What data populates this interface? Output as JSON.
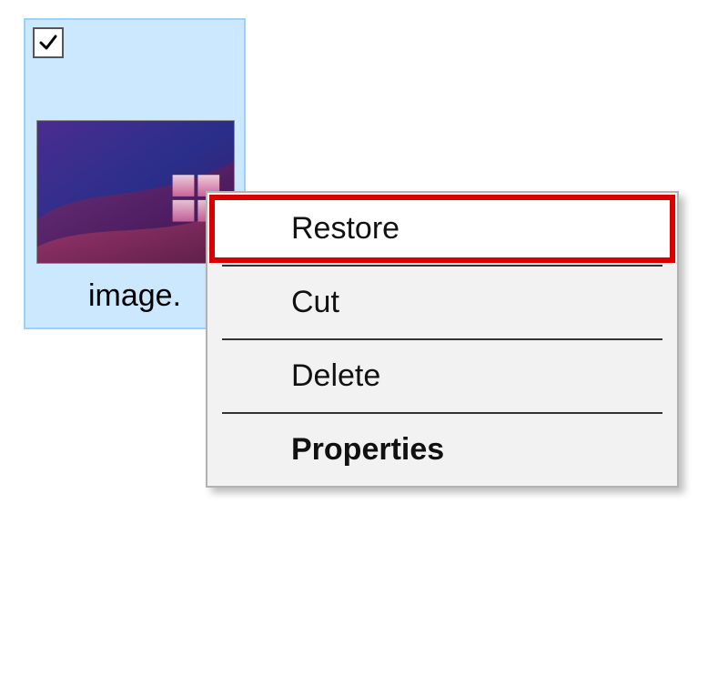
{
  "file": {
    "name_visible": "image.",
    "checked": true
  },
  "context_menu": {
    "items": [
      {
        "label": "Restore",
        "highlighted": true,
        "bold": false
      },
      {
        "label": "Cut",
        "highlighted": false,
        "bold": false
      },
      {
        "label": "Delete",
        "highlighted": false,
        "bold": false
      },
      {
        "label": "Properties",
        "highlighted": false,
        "bold": true
      }
    ]
  }
}
